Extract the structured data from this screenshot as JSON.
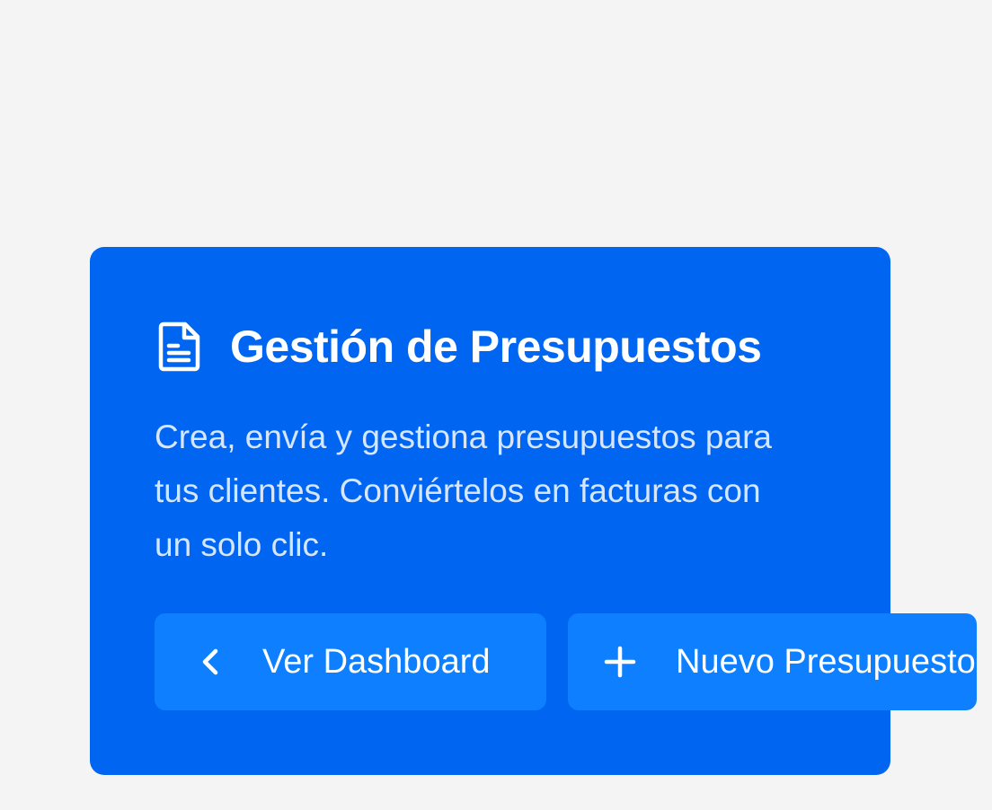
{
  "card": {
    "title": "Gestión de Presupuestos",
    "description": "Crea, envía y gestiona presupuestos para tus clientes. Conviértelos en facturas con un solo clic.",
    "icon": "document-icon",
    "background_color": "#0066f2"
  },
  "buttons": {
    "dashboard": {
      "label": "Ver Dashboard",
      "icon": "chevron-left-icon"
    },
    "new_budget": {
      "label": "Nuevo Presupuesto",
      "icon": "plus-icon"
    },
    "background_color": "#0e80ff"
  },
  "page": {
    "background_color": "#f4f4f5"
  }
}
